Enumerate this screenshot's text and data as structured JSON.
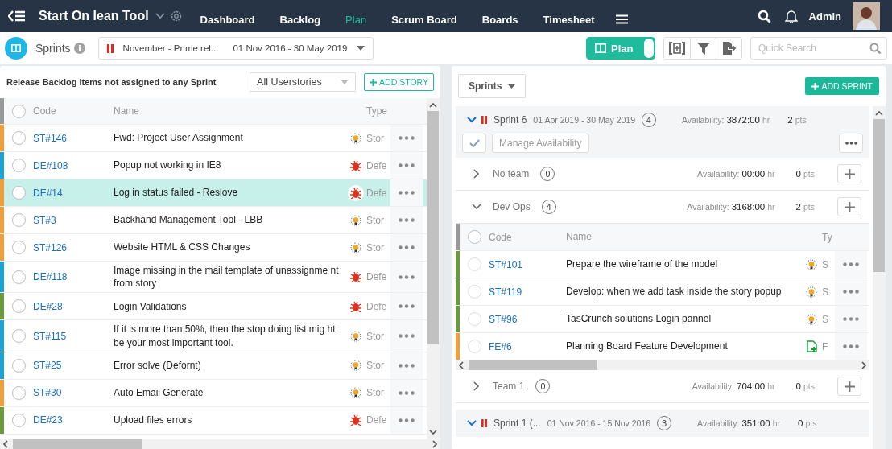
{
  "app": {
    "title": "Start On lean Tool"
  },
  "nav": [
    {
      "label": "Dashboard",
      "selected": false
    },
    {
      "label": "Backlog",
      "selected": false
    },
    {
      "label": "Plan",
      "selected": true
    },
    {
      "label": "Scrum Board",
      "selected": false
    },
    {
      "label": "Boards",
      "selected": false
    },
    {
      "label": "Timesheet",
      "selected": false
    }
  ],
  "user": {
    "name": "Admin"
  },
  "toolbar": {
    "section": "Sprints",
    "release": {
      "name": "November - Prime rel...",
      "dates": "01 Nov 2016 - 30 May 2019"
    },
    "view_toggle": {
      "label": "Plan",
      "on": true
    },
    "search": {
      "placeholder": "Quick Search"
    }
  },
  "backlog": {
    "title": "Release Backlog items not assigned to any Sprint",
    "filter": "All Userstories",
    "add_button": "ADD STORY",
    "columns": [
      "Code",
      "Name",
      "Type"
    ],
    "all_checked": false,
    "rows": [
      {
        "code": "ST#146",
        "name": "Fwd: Project User Assignment",
        "kind": "story",
        "type": "Stor",
        "color": "#f19d38",
        "selected": false
      },
      {
        "code": "DE#108",
        "name": "Popup not working in IE8",
        "kind": "defect",
        "type": "Defe",
        "color": "#1ba3d8",
        "selected": false
      },
      {
        "code": "DE#14",
        "name": "Log in status failed - Reslove",
        "kind": "defect",
        "type": "Defe",
        "color": "#f19d38",
        "selected": true
      },
      {
        "code": "ST#3",
        "name": "Backhand Management Tool - LBB",
        "kind": "story",
        "type": "Stor",
        "color": "#f19d38",
        "selected": false
      },
      {
        "code": "ST#126",
        "name": "Website HTML & CSS Changes",
        "kind": "story",
        "type": "Stor",
        "color": "#f19d38",
        "selected": false
      },
      {
        "code": "DE#118",
        "name": "Image missing in the mail template of unassignme nt from story",
        "kind": "defect",
        "type": "Defe",
        "color": "#1ba3d8",
        "selected": false
      },
      {
        "code": "DE#28",
        "name": "Login Validations",
        "kind": "defect",
        "type": "Defe",
        "color": "#6b9a3c",
        "selected": false
      },
      {
        "code": "ST#115",
        "name": "If it is more than 50%, then the stop doing list mig ht be your most important tool.",
        "kind": "story",
        "type": "Stor",
        "color": "#1ba3d8",
        "selected": false
      },
      {
        "code": "ST#25",
        "name": "Error solve (Defornt)",
        "kind": "story",
        "type": "Stor",
        "color": "#1ba3d8",
        "selected": false
      },
      {
        "code": "ST#30",
        "name": "Auto Email Generate",
        "kind": "story",
        "type": "Stor",
        "color": "#f19d38",
        "selected": false
      },
      {
        "code": "DE#23",
        "name": "Upload files errors",
        "kind": "defect",
        "type": "Defe",
        "color": "#6b9a3c",
        "selected": false
      }
    ]
  },
  "sprints_panel": {
    "filter": "Sprints",
    "add_button": "ADD SPRINT",
    "sprints": [
      {
        "name": "Sprint 6",
        "dates": "01 Apr 2019 - 30 May 2019",
        "count": "4",
        "availability_label": "Availability:",
        "availability": "3872:00",
        "unit": "hr",
        "points": "2",
        "points_unit": "pts",
        "expanded": true,
        "manage_button": "Manage Availability",
        "teams": [
          {
            "name": "No team",
            "count": "0",
            "availability_label": "Availability:",
            "availability": "00:00",
            "unit": "hr",
            "points": "0",
            "points_unit": "pts",
            "expanded": false
          },
          {
            "name": "Dev Ops",
            "count": "4",
            "availability_label": "Availability:",
            "availability": "3168:00",
            "unit": "hr",
            "points": "2",
            "points_unit": "pts",
            "expanded": true,
            "columns": [
              "Code",
              "Name",
              "Ty"
            ],
            "all_checked": false,
            "rows": [
              {
                "code": "ST#101",
                "name": "Prepare the wireframe of the model",
                "kind": "story",
                "type": "S",
                "color": "#6b9a3c",
                "checked": false
              },
              {
                "code": "ST#119",
                "name": "Develop: when we add task inside the story popup",
                "kind": "story",
                "type": "S",
                "color": "#6b9a3c",
                "checked": false
              },
              {
                "code": "ST#96",
                "name": "TasCrunch solutions Login pannel",
                "kind": "story",
                "type": "S",
                "color": "#6b9a3c",
                "checked": false
              },
              {
                "code": "FE#6",
                "name": "Planning Board Feature Development",
                "kind": "feature",
                "type": "F",
                "color": "#f19d38",
                "checked": false
              }
            ]
          },
          {
            "name": "Team 1",
            "count": "0",
            "availability_label": "Availability:",
            "availability": "704:00",
            "unit": "hr",
            "points": "0",
            "points_unit": "pts",
            "expanded": false
          }
        ]
      },
      {
        "name": "Sprint 1 (...",
        "dates": "01 Nov 2016 - 15 Nov 2016",
        "count": "3",
        "availability_label": "Availability:",
        "availability": "351:00",
        "unit": "hr",
        "points": "0",
        "points_unit": "pts",
        "expanded": true
      }
    ]
  }
}
